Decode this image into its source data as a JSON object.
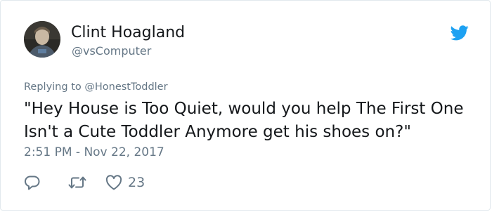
{
  "tweet": {
    "author_name": "Clint Hoagland",
    "author_handle": "@vsComputer",
    "replying_label": "Replying to ",
    "replying_to": "@HonestToddler",
    "text": "\"Hey House is Too Quiet, would you help The First One Isn't a Cute Toddler Anymore get his shoes on?\"",
    "timestamp": "2:51 PM - Nov 22, 2017",
    "like_count": "23"
  },
  "icons": {
    "brand": "twitter-bird-icon",
    "reply": "reply-icon",
    "retweet": "retweet-icon",
    "like": "heart-icon"
  },
  "colors": {
    "brand_blue": "#1da1f2",
    "secondary_text": "#657786",
    "primary_text": "#14171a",
    "border": "#e1e8ed"
  }
}
